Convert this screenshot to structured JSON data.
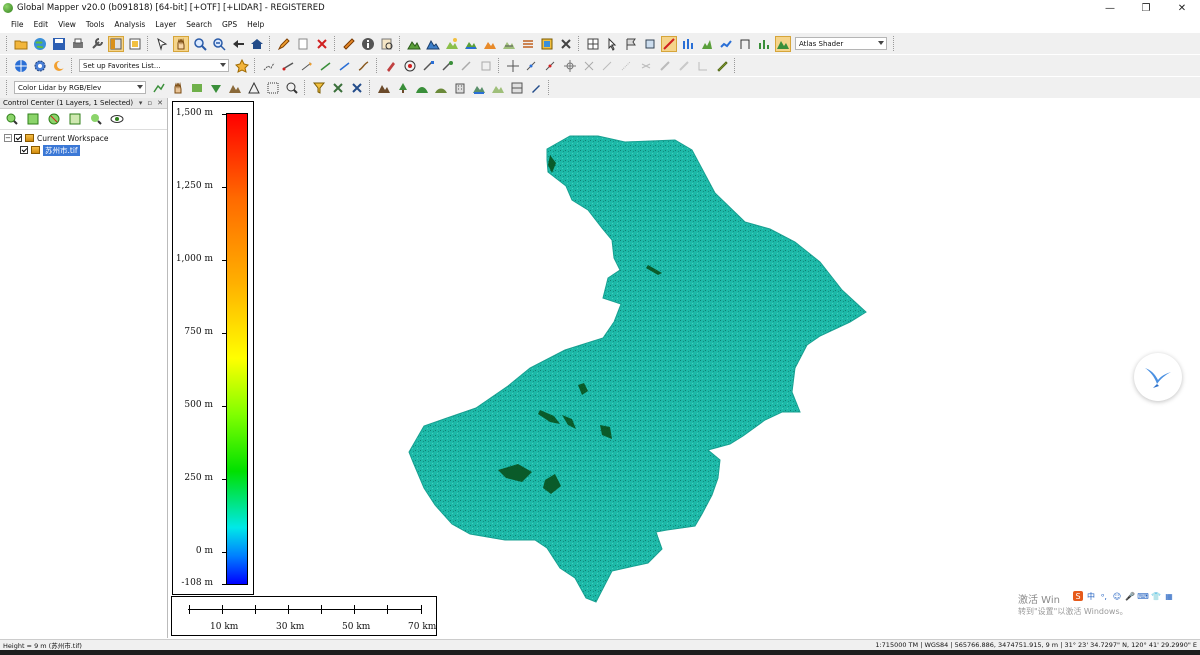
{
  "window": {
    "title": "Global Mapper v20.0 (b091818) [64-bit] [+OTF] [+LIDAR] - REGISTERED",
    "minimize": "—",
    "restore": "❐",
    "close": "✕"
  },
  "menu": [
    "File",
    "Edit",
    "View",
    "Tools",
    "Analysis",
    "Layer",
    "Search",
    "GPS",
    "Help"
  ],
  "toolbar": {
    "shader_select": "Atlas Shader",
    "favorites_select": "Set up Favorites List...",
    "lidar_color_select": "Color Lidar by RGB/Elev"
  },
  "control_center": {
    "header": "Control Center (1 Layers, 1 Selected)",
    "workspace_label": "Current Workspace",
    "layer_label": "苏州市.tif"
  },
  "legend": {
    "labels": [
      "1,500 m",
      "1,250 m",
      "1,000 m",
      "750 m",
      "500 m",
      "250 m",
      "0 m",
      "-108 m"
    ]
  },
  "scalebar": {
    "labels": [
      "10 km",
      "30 km",
      "50 km",
      "70 km"
    ]
  },
  "status": {
    "left": "Height = 9 m (苏州市.tif)",
    "right": "1:715000  TM | WGS84 | 565766.886, 3474751.915, 9 m | 31° 23' 34.7297\" N, 120° 41' 29.2990\" E"
  },
  "watermark": {
    "line1": "激活 Win",
    "line2": "转到\"设置\"以激活 Windows。"
  },
  "ime": [
    "中",
    "ᵒ,",
    "☺",
    "🎤",
    "⌨",
    "👕",
    "▦"
  ],
  "colors": {
    "terrain": "#1fb8a8",
    "terrain_edge": "#17a091",
    "relief": "#0a5b2a"
  }
}
